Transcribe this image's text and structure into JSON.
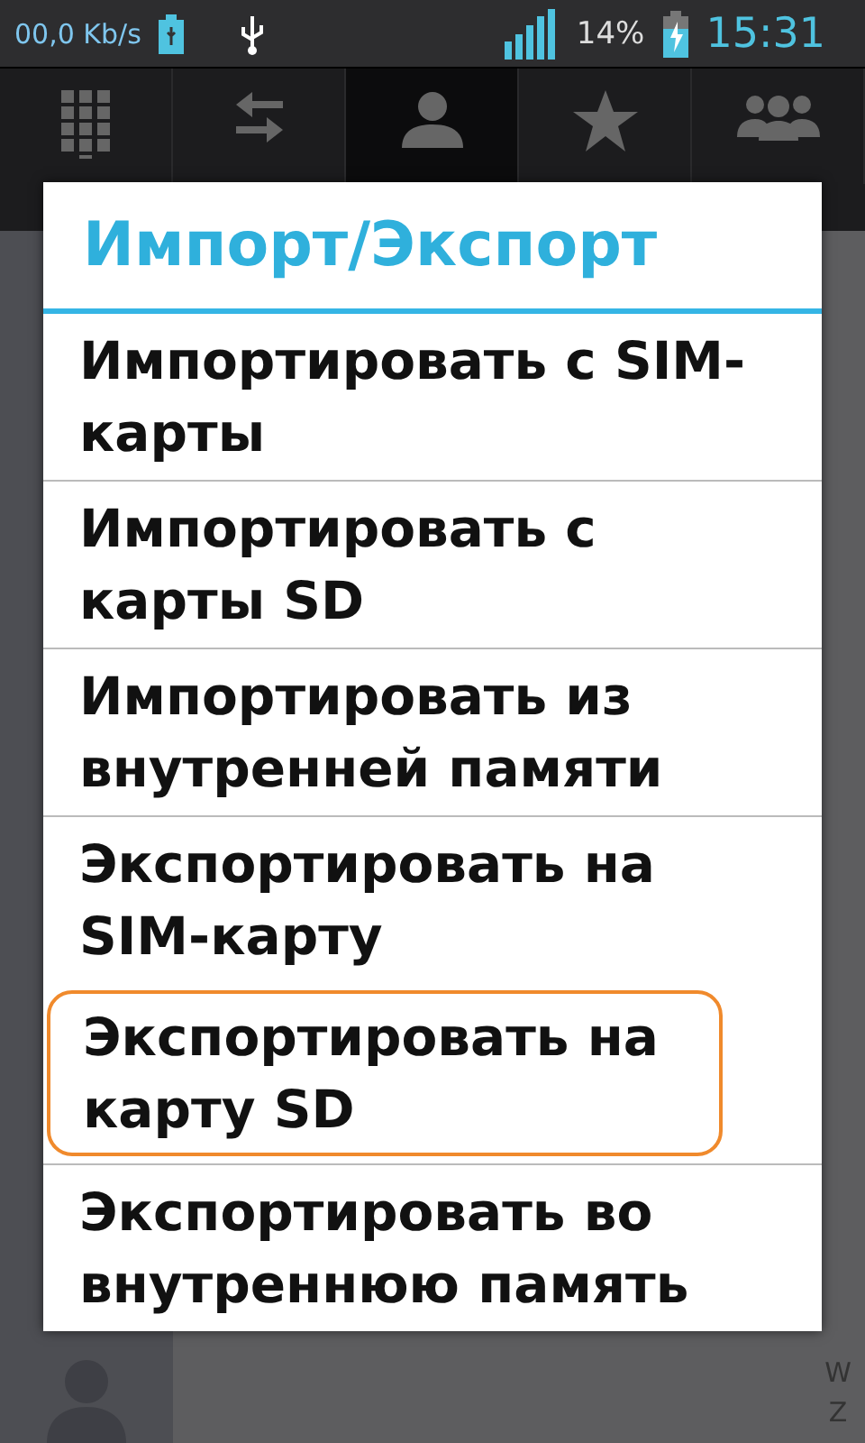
{
  "status_bar": {
    "speed": "00,0 Kb/s",
    "battery": "14%",
    "time": "15:31"
  },
  "tabs": [
    {
      "kind": "dialpad",
      "selected": false
    },
    {
      "kind": "swap",
      "selected": false
    },
    {
      "kind": "person",
      "selected": true
    },
    {
      "kind": "star",
      "selected": false
    },
    {
      "kind": "group",
      "selected": false
    }
  ],
  "index_letters": [
    "W",
    "Z"
  ],
  "dialog": {
    "title": "Импорт/Экспорт",
    "items": [
      {
        "label": "Импортировать с SIM-карты",
        "selected": false
      },
      {
        "label": "Импортировать с карты SD",
        "selected": false
      },
      {
        "label": "Импортировать из внутренней памяти",
        "selected": false
      },
      {
        "label": "Экспортировать на SIM-карту",
        "selected": false
      },
      {
        "label": "Экспортировать на карту SD",
        "selected": true
      },
      {
        "label": "Экспортировать во внутреннюю память",
        "selected": false
      }
    ]
  }
}
